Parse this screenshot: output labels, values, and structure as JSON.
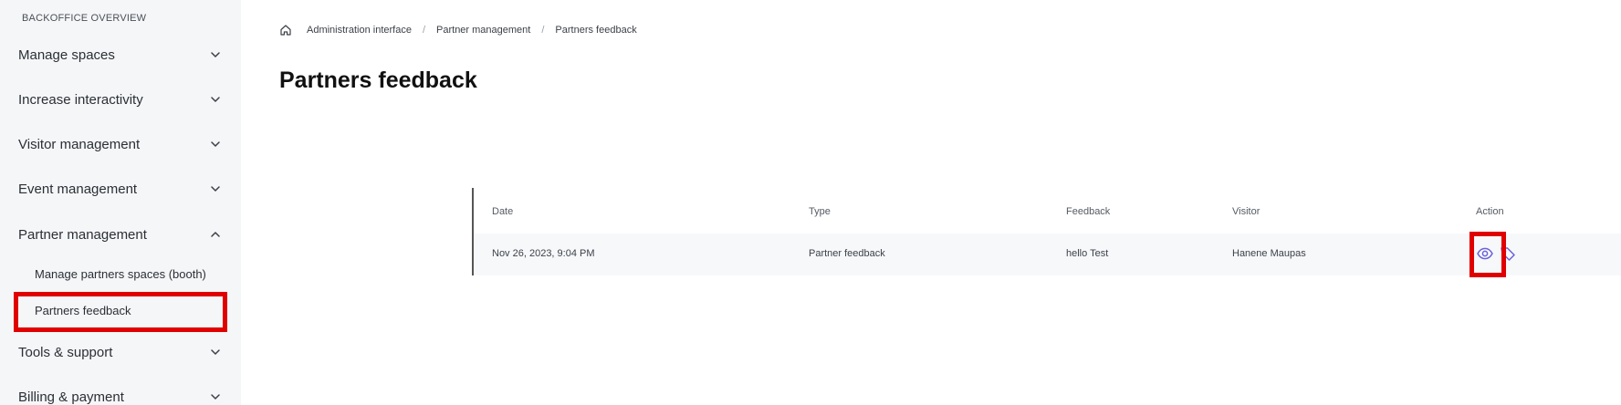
{
  "sidebar": {
    "heading": "BACKOFFICE OVERVIEW",
    "items": [
      {
        "label": "Manage spaces",
        "expanded": false
      },
      {
        "label": "Increase interactivity",
        "expanded": false
      },
      {
        "label": "Visitor management",
        "expanded": false
      },
      {
        "label": "Event management",
        "expanded": false
      },
      {
        "label": "Partner management",
        "expanded": true
      },
      {
        "label": "Tools & support",
        "expanded": false
      },
      {
        "label": "Billing & payment",
        "expanded": false
      }
    ],
    "sub_items": [
      {
        "label": "Manage partners spaces (booth)"
      },
      {
        "label": "Partners feedback",
        "active": true
      }
    ]
  },
  "breadcrumb": {
    "home_icon": "home-icon",
    "items": [
      "Administration interface",
      "Partner management",
      "Partners feedback"
    ],
    "separator": "/"
  },
  "page": {
    "title": "Partners feedback"
  },
  "table": {
    "columns": [
      "Date",
      "Type",
      "Feedback",
      "Visitor",
      "Action"
    ],
    "rows": [
      {
        "date": "Nov 26, 2023, 9:04 PM",
        "type": "Partner feedback",
        "feedback": "hello Test",
        "visitor": "Hanene Maupas",
        "actions": [
          "eye-icon",
          "tag-icon"
        ]
      }
    ]
  },
  "colors": {
    "sidebar_bg": "#f5f6f7",
    "accent_icon": "#6b63d9",
    "highlight": "#e00000",
    "row_bg": "#f7f8fa"
  }
}
